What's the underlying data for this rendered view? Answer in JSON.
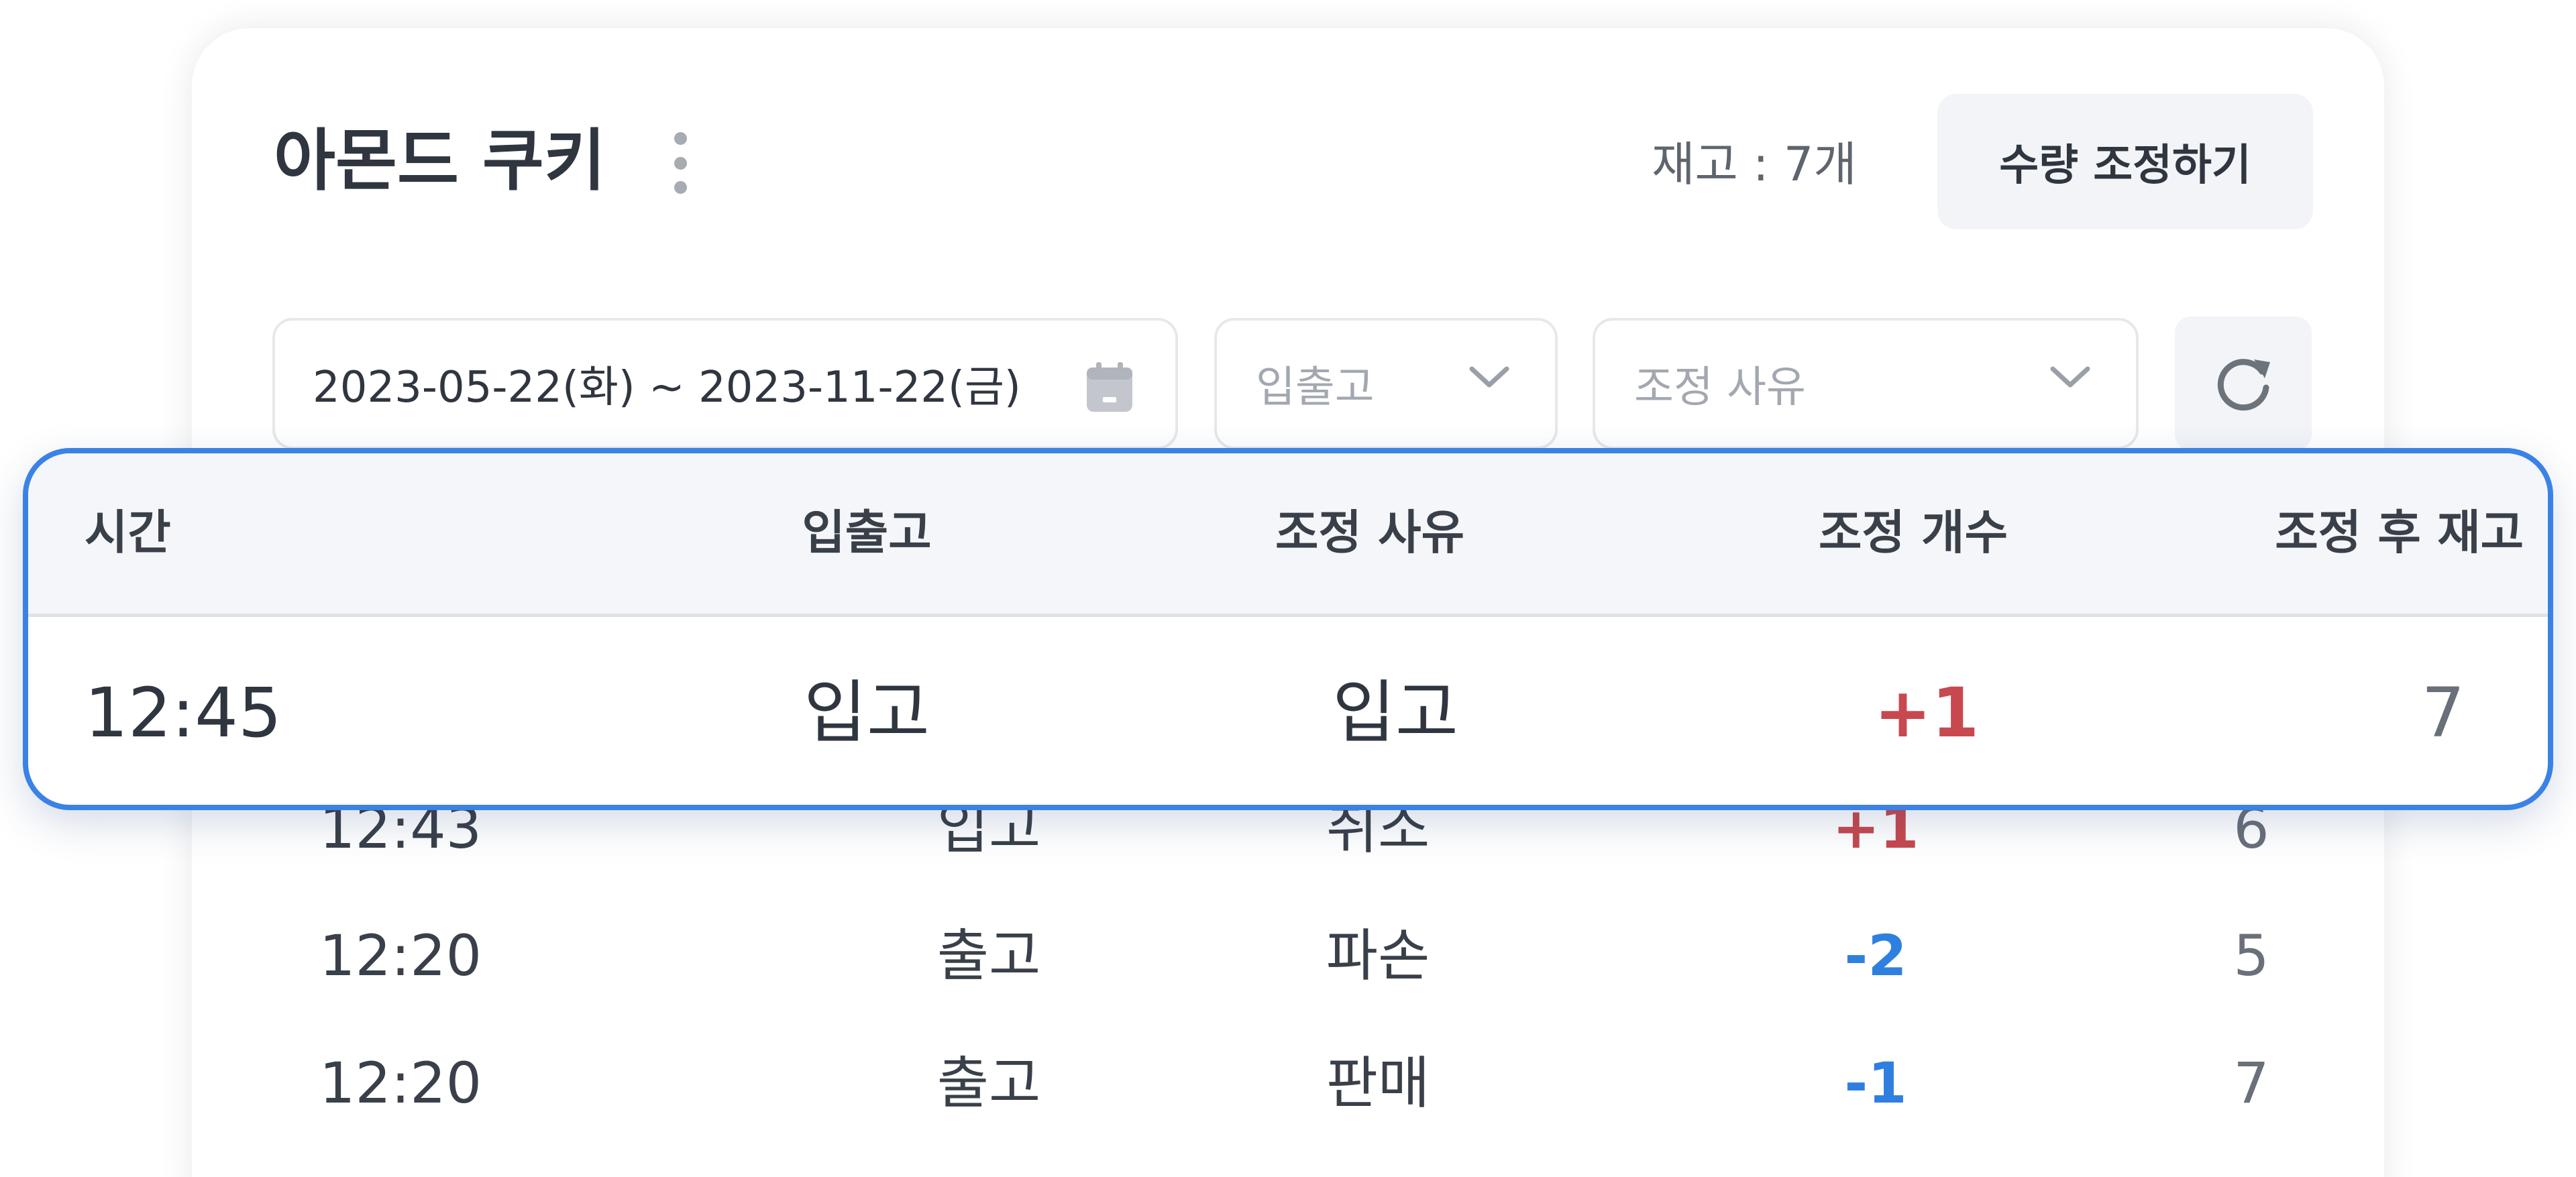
{
  "header": {
    "title": "아몬드 쿠키",
    "stock_text": "재고 : 7개",
    "adjust_button": "수량 조정하기"
  },
  "filters": {
    "date_range": "2023-05-22(화) ~ 2023-11-22(금)",
    "type_placeholder": "입출고",
    "reason_placeholder": "조정 사유"
  },
  "table": {
    "columns": [
      "시간",
      "입출고",
      "조정 사유",
      "조정 개수",
      "조정 후 재고"
    ],
    "highlighted_row": {
      "time": "12:45",
      "type": "입고",
      "reason": "입고",
      "count": "+1",
      "after": "7"
    },
    "rows": [
      {
        "time": "12:43",
        "type": "입고",
        "reason": "취소",
        "count": "+1",
        "after": "6"
      },
      {
        "time": "12:20",
        "type": "출고",
        "reason": "파손",
        "count": "-2",
        "after": "5"
      },
      {
        "time": "12:20",
        "type": "출고",
        "reason": "판매",
        "count": "-1",
        "after": "7"
      }
    ]
  },
  "colors": {
    "accent_border": "#3b82e6",
    "positive": "#c7494f",
    "negative": "#2f7fe0"
  },
  "icons": {
    "more": "kebab-menu-icon",
    "calendar": "calendar-icon",
    "dropdown": "chevron-down-icon",
    "refresh": "refresh-icon"
  }
}
